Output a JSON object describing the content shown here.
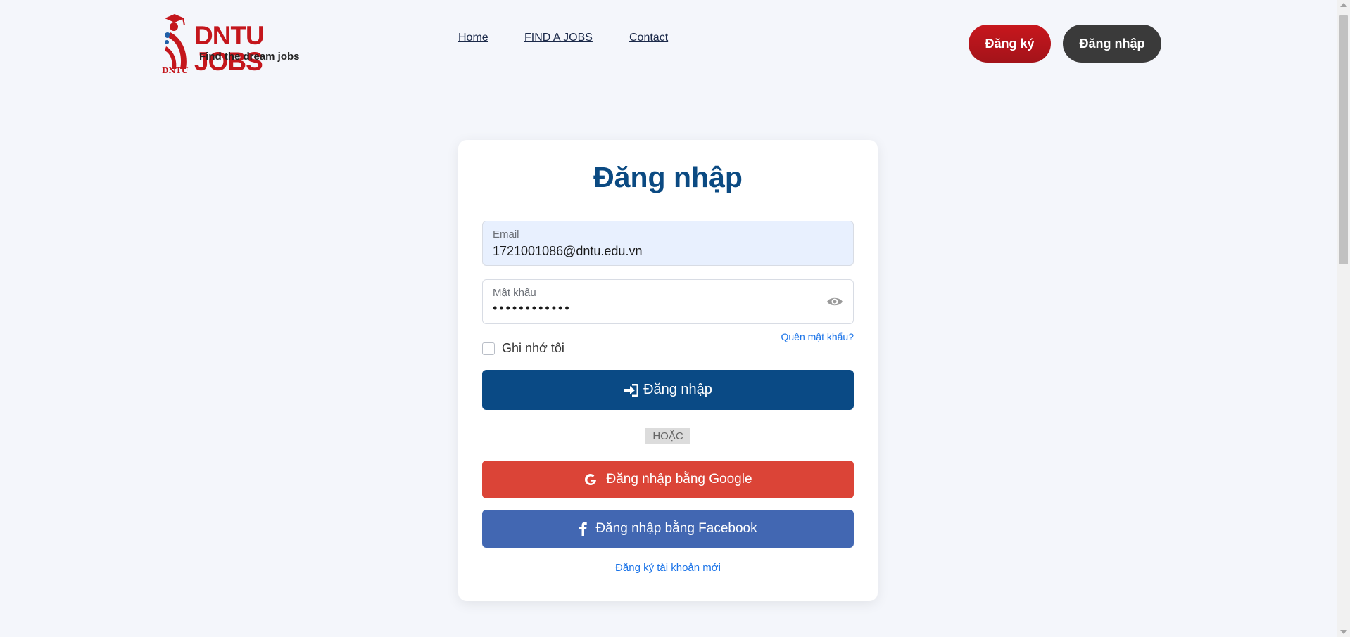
{
  "brand": {
    "name": "DNTU JOBS",
    "tagline": "Find the dream jobs",
    "mini": "DNTU"
  },
  "nav": {
    "home": "Home",
    "find_jobs": "FIND A JOBS",
    "contact": "Contact"
  },
  "header_buttons": {
    "register": "Đăng ký",
    "login": "Đăng nhập"
  },
  "login_form": {
    "title": "Đăng nhập",
    "email_label": "Email",
    "email_value": "1721001086@dntu.edu.vn",
    "password_label": "Mật khẩu",
    "password_mask": "••••••••••••",
    "forgot_password": "Quên mật khẩu?",
    "remember_me": "Ghi nhớ tôi",
    "submit_label": "Đăng nhập",
    "or_separator": "HOẶC",
    "google_label": "Đăng nhập bằng Google",
    "facebook_label": "Đăng nhập bằng Facebook",
    "register_link": "Đăng ký tài khoản mới"
  },
  "colors": {
    "brand_red": "#c4161c",
    "primary_blue": "#0a4a85",
    "google_red": "#db4437",
    "facebook_blue": "#4267b2",
    "link_blue": "#1a73e8"
  }
}
